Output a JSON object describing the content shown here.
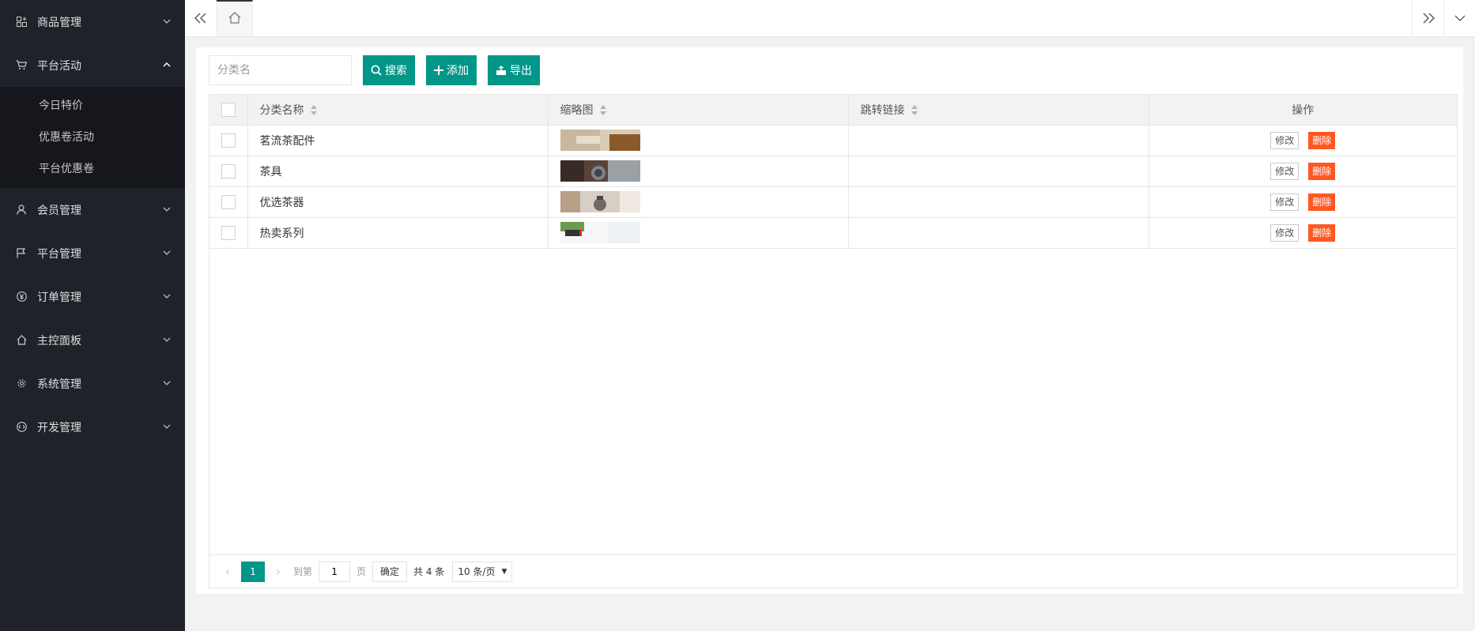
{
  "sidebar": {
    "items": [
      {
        "label": "商品管理",
        "icon": "grid-plus-icon",
        "expanded": false
      },
      {
        "label": "平台活动",
        "icon": "cart-icon",
        "expanded": true,
        "children": [
          "今日特价",
          "优惠卷活动",
          "平台优惠卷"
        ]
      },
      {
        "label": "会员管理",
        "icon": "user-icon",
        "expanded": false
      },
      {
        "label": "平台管理",
        "icon": "flag-icon",
        "expanded": false
      },
      {
        "label": "订单管理",
        "icon": "yen-icon",
        "expanded": false
      },
      {
        "label": "主控面板",
        "icon": "home-icon",
        "expanded": false
      },
      {
        "label": "系统管理",
        "icon": "gear-icon",
        "expanded": false
      },
      {
        "label": "开发管理",
        "icon": "code-icon",
        "expanded": false
      }
    ]
  },
  "toolbar": {
    "search_placeholder": "分类名",
    "search_label": "搜索",
    "add_label": "添加",
    "export_label": "导出"
  },
  "table": {
    "headers": [
      "分类名称",
      "缩略图",
      "跳转链接",
      "操作"
    ],
    "rows": [
      {
        "name": "茗流茶配件",
        "link": "",
        "thumb_colors": [
          "#c9b7a0",
          "#8b5a2b"
        ]
      },
      {
        "name": "茶具",
        "link": "",
        "thumb_colors": [
          "#3a2a24",
          "#9aa0a4"
        ]
      },
      {
        "name": "优选茶器",
        "link": "",
        "thumb_colors": [
          "#d8cfc4",
          "#6f6a66"
        ]
      },
      {
        "name": "热卖系列",
        "link": "",
        "thumb_colors": [
          "#f5f5f5",
          "#6c9a4c"
        ]
      }
    ],
    "edit_label": "修改",
    "delete_label": "删除"
  },
  "pager": {
    "current": "1",
    "goto_prefix": "到第",
    "goto_value": "1",
    "goto_suffix": "页",
    "confirm_label": "确定",
    "total_text": "共 4 条",
    "page_size": "10 条/页"
  },
  "colors": {
    "accent": "#009688",
    "danger": "#ff5722",
    "sidebar_bg": "#20222a"
  }
}
